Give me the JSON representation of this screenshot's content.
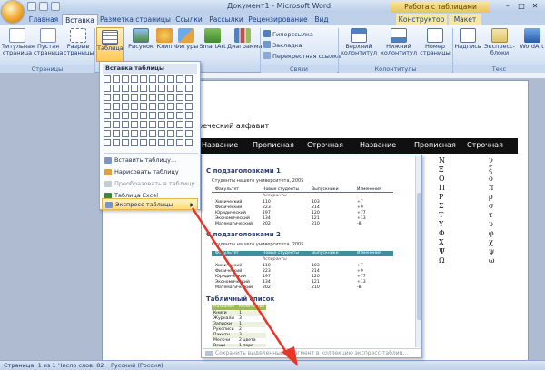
{
  "window": {
    "title": "Документ1 - Microsoft Word",
    "context_tab": "Работа с таблицами",
    "controls": [
      "–",
      "□",
      "✕"
    ]
  },
  "tabs": [
    {
      "label": "Главная"
    },
    {
      "label": "Вставка"
    },
    {
      "label": "Разметка страницы"
    },
    {
      "label": "Ссылки"
    },
    {
      "label": "Рассылки"
    },
    {
      "label": "Рецензирование"
    },
    {
      "label": "Вид"
    },
    {
      "label": "Конструктор"
    },
    {
      "label": "Макет"
    }
  ],
  "ribbon": {
    "pages_group": {
      "title_page": "Титульная страница",
      "blank_page": "Пустая страница",
      "page_break": "Разрыв страницы",
      "label": "Страницы"
    },
    "table_btn": "Таблица",
    "illustrations": [
      "Рисунок",
      "Клип",
      "Фигуры",
      "SmartArt",
      "Диаграмма"
    ],
    "links": [
      "Гиперссылка",
      "Закладка",
      "Перекрестная ссылка"
    ],
    "links_label": "Связи",
    "header_footer": {
      "header": "Верхний колонтитул",
      "footer": "Нижний колонтитул",
      "page_number": "Номер страницы",
      "label": "Колонтитулы"
    },
    "text_group": [
      "Надпись",
      "Экспресс-блоки",
      "WordArt"
    ],
    "text_label": "Текс"
  },
  "table_menu": {
    "title": "Вставка таблицы",
    "items": [
      {
        "label": "Вставить таблицу...",
        "state": "normal"
      },
      {
        "label": "Нарисовать таблицу",
        "state": "normal"
      },
      {
        "label": "Преобразовать в таблицу...",
        "state": "disabled"
      },
      {
        "label": "Таблица Excel",
        "state": "normal"
      },
      {
        "label": "Экспресс-таблицы",
        "state": "hot"
      }
    ]
  },
  "document": {
    "heading": "реческий алфавит",
    "table_headers": [
      "Название",
      "Прописная",
      "Строчная",
      "Название",
      "Прописная",
      "Строчная"
    ],
    "upper_greek": [
      "Ν",
      "Ξ",
      "Ο",
      "Π",
      "Ρ",
      "Σ",
      "Τ",
      "Υ",
      "Φ",
      "Χ",
      "Ψ",
      "Ω"
    ],
    "lower_greek": [
      "ν",
      "ξ",
      "ο",
      "π",
      "ρ",
      "σ",
      "τ",
      "υ",
      "φ",
      "χ",
      "ψ",
      "ω"
    ]
  },
  "gallery": {
    "sections": [
      {
        "heading": "С подзаголовками 1",
        "subtitle": "Студенты нашего университета, 2005",
        "header_row": [
          "Факультет",
          "Новые студенты",
          "Выпускники",
          "Изменения"
        ],
        "group_label": "Аспиранты",
        "rows": [
          [
            "Химический",
            "110",
            "103",
            "+7"
          ],
          [
            "Физический",
            "223",
            "214",
            "+9"
          ],
          [
            "Юридический",
            "197",
            "120",
            "+77"
          ],
          [
            "Экономический",
            "134",
            "121",
            "+13"
          ],
          [
            "Математический",
            "202",
            "210",
            "-8"
          ]
        ]
      },
      {
        "heading": "С подзаголовками 2",
        "subtitle": "Студенты нашего университета, 2005",
        "header_row": [
          "Факультет",
          "Новые студенты",
          "Выпускники",
          "Изменения"
        ],
        "group_label": "Аспиранты",
        "rows": [
          [
            "Химический",
            "110",
            "103",
            "+7"
          ],
          [
            "Физический",
            "223",
            "214",
            "+9"
          ],
          [
            "Юридический",
            "197",
            "120",
            "+77"
          ],
          [
            "Экономический",
            "134",
            "121",
            "+13"
          ],
          [
            "Математический",
            "202",
            "210",
            "-8"
          ]
        ]
      }
    ],
    "list_heading": "Табличный список",
    "list_header": [
      "Название",
      "Количество"
    ],
    "list_rows": [
      [
        "Книги",
        "1"
      ],
      [
        "Журналы",
        "3"
      ],
      [
        "Записки",
        "1"
      ],
      [
        "Рукописи",
        "2"
      ],
      [
        "Пакеты",
        "3"
      ],
      [
        "Мелочи",
        "2 цвета"
      ],
      [
        "Вещи",
        "1 пара"
      ]
    ],
    "footer": "Сохранить выделенный фрагмент в коллекцию экспресс-таблиц..."
  },
  "status": {
    "page": "Страница: 1 из 1",
    "words": "Число слов: 82",
    "language": "Русский (Россия)"
  },
  "colors": {
    "ribbon_blue": "#15428b",
    "highlight": "#ffd97a",
    "arrow": "#e8352a",
    "table_header": "#101010",
    "gallery_header_1": "#4f6fa8",
    "gallery_header_2": "#3d8fa0",
    "list_header": "#9bbb59"
  }
}
